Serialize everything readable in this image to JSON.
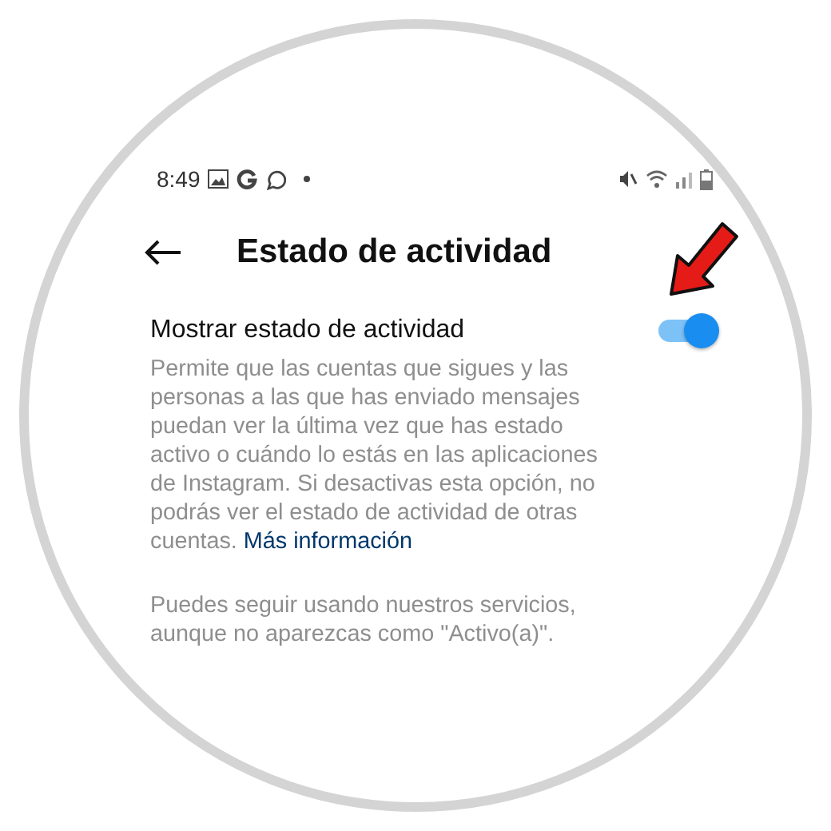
{
  "status_bar": {
    "time": "8:49"
  },
  "header": {
    "title": "Estado de actividad"
  },
  "setting": {
    "label": "Mostrar estado de actividad",
    "on": true,
    "description": "Permite que las cuentas que sigues y las personas a las que has enviado mensajes puedan ver la última vez que has estado activo o cuándo lo estás en las aplicaciones de Instagram. Si desactivas esta opción, no podrás ver el estado de actividad de otras cuentas.",
    "link": "Más información"
  },
  "note": "Puedes seguir usando nuestros servicios, aunque no aparezcas como \"Activo(a)\"."
}
